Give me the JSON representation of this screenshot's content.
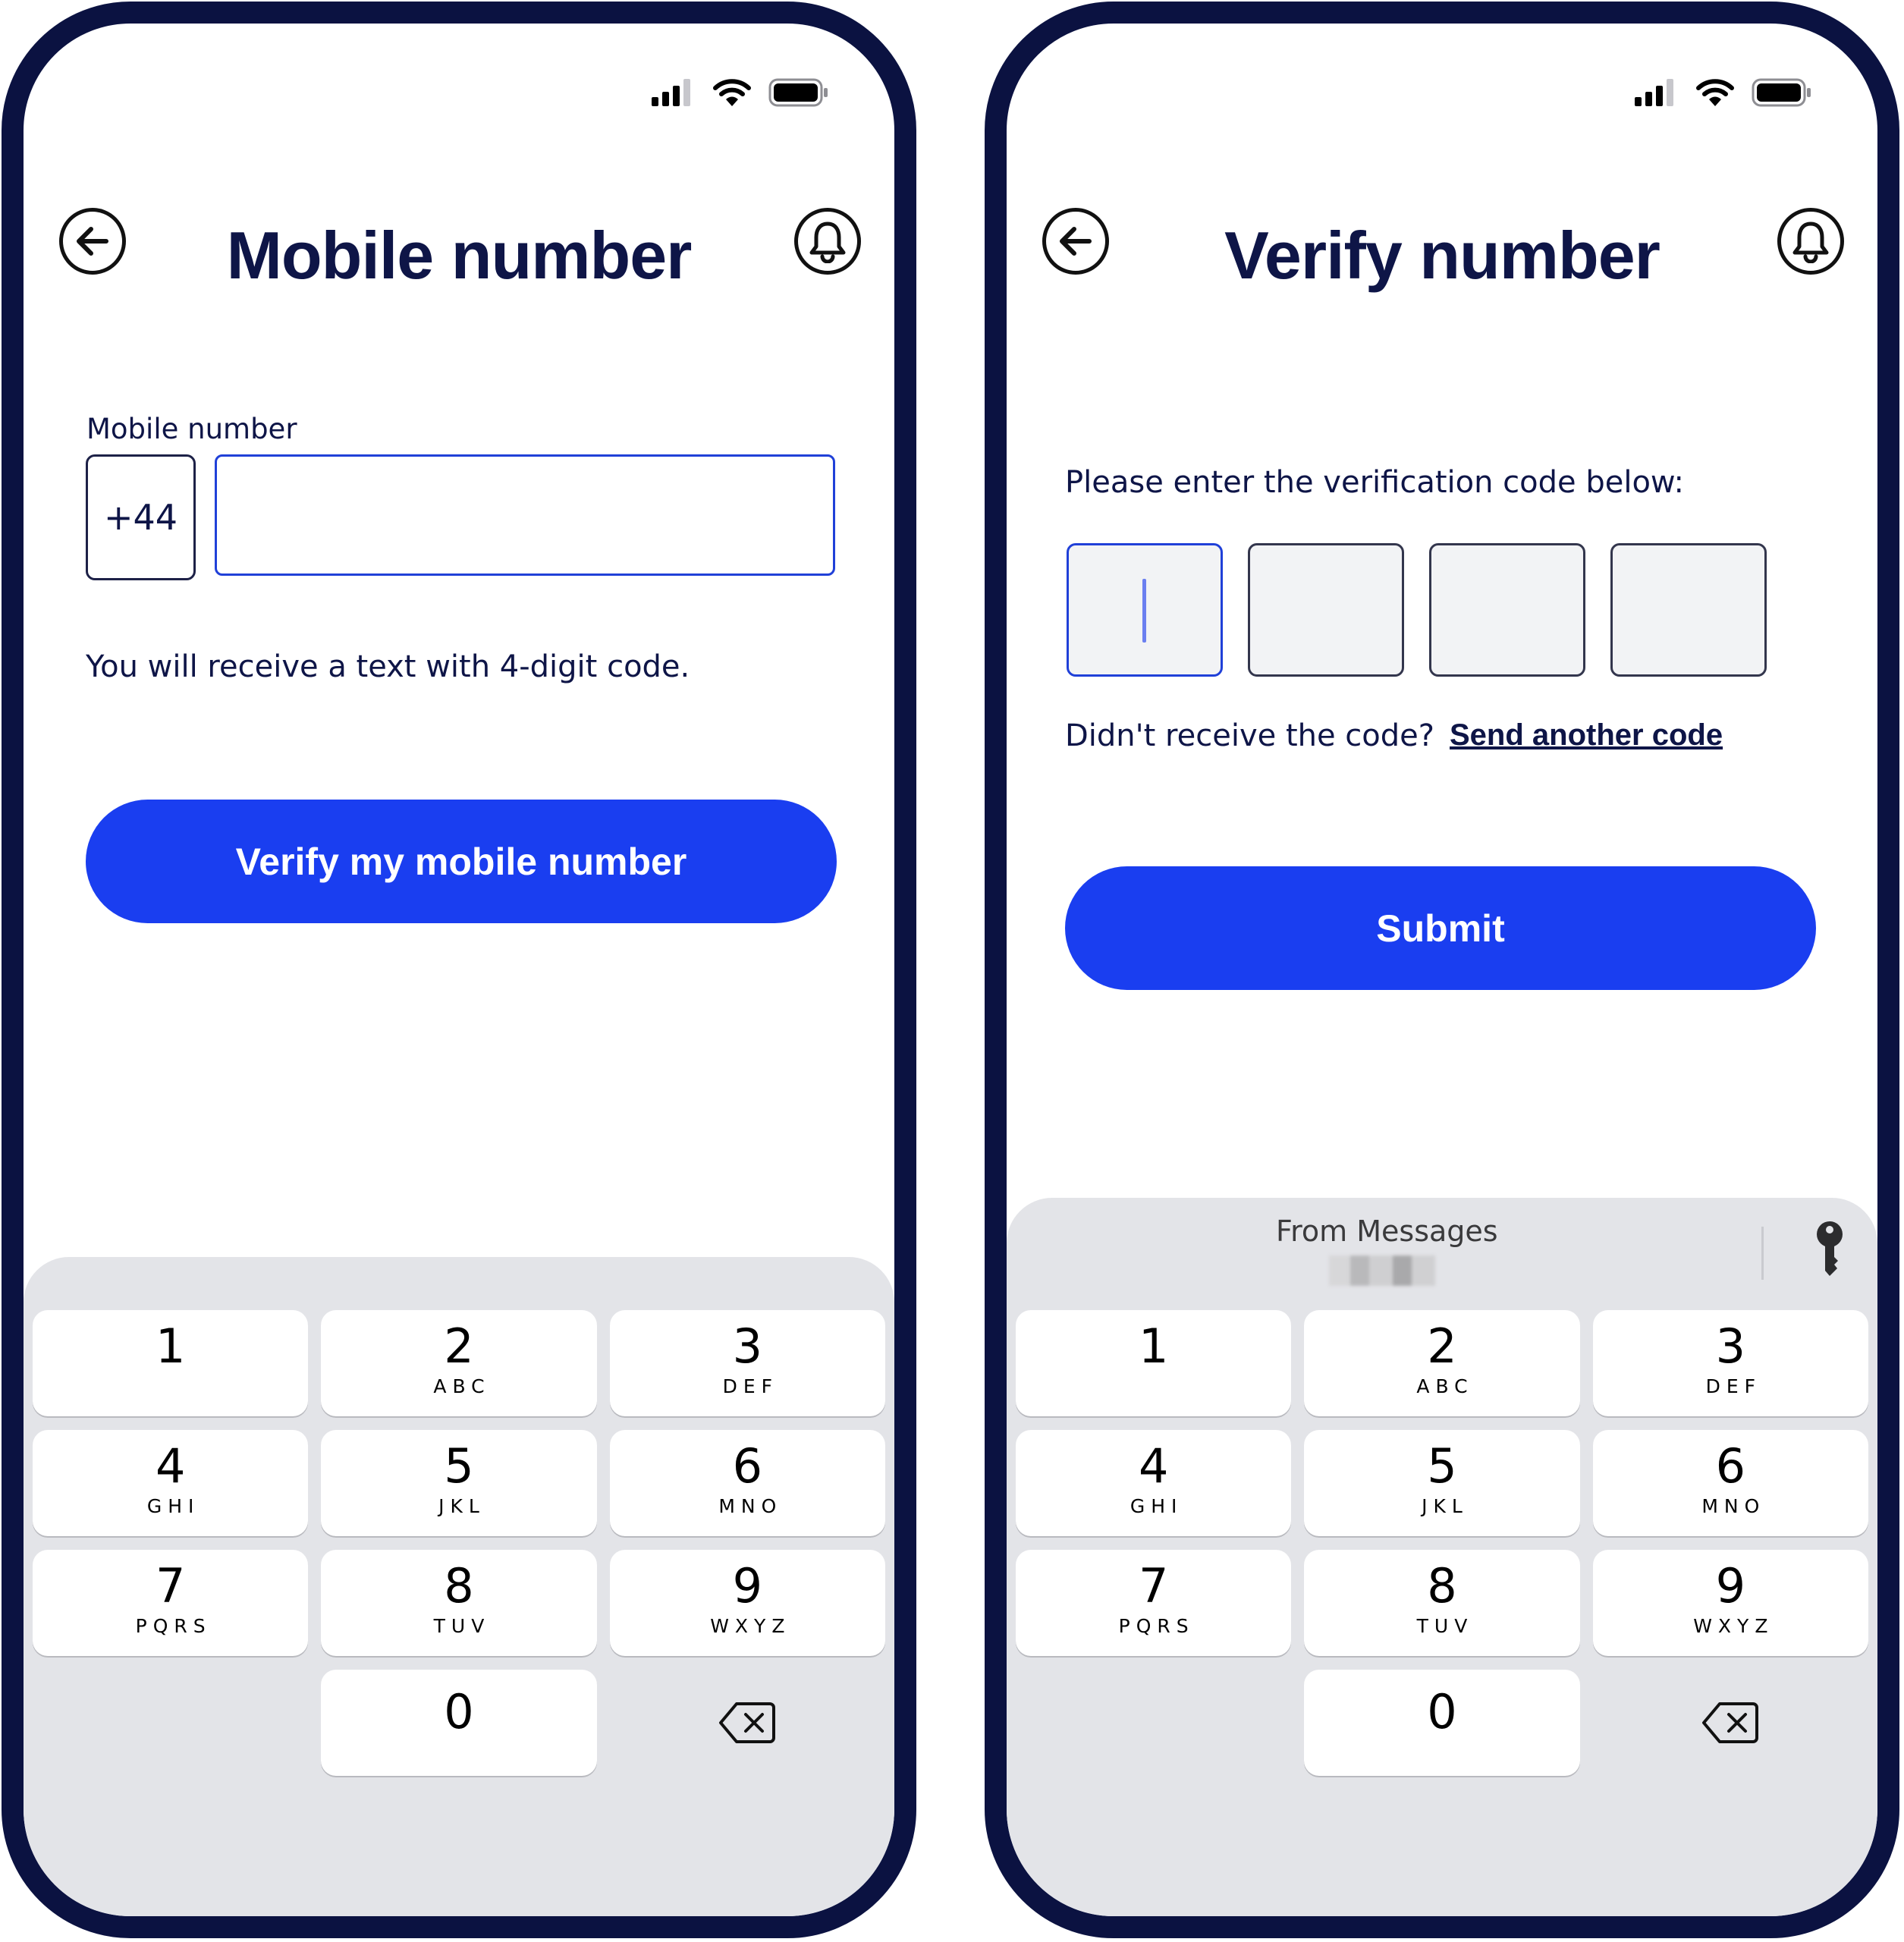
{
  "screens": [
    {
      "title": "Mobile number",
      "field_label": "Mobile number",
      "country_code": "+44",
      "phone_value": "",
      "helper_text": "You will receive a text with 4-digit code.",
      "primary_button": "Verify my mobile number"
    },
    {
      "title": "Verify number",
      "instruction": "Please enter the verification code below:",
      "code_digits": [
        "",
        "",
        "",
        ""
      ],
      "resend_prompt": "Didn't receive the code?",
      "resend_link": "Send another code",
      "primary_button": "Submit",
      "suggestion_label": "From Messages"
    }
  ],
  "keypad": [
    {
      "num": "1",
      "letters": ""
    },
    {
      "num": "2",
      "letters": "ABC"
    },
    {
      "num": "3",
      "letters": "DEF"
    },
    {
      "num": "4",
      "letters": "GHI"
    },
    {
      "num": "5",
      "letters": "JKL"
    },
    {
      "num": "6",
      "letters": "MNO"
    },
    {
      "num": "7",
      "letters": "PQRS"
    },
    {
      "num": "8",
      "letters": "TUV"
    },
    {
      "num": "9",
      "letters": "WXYZ"
    },
    {
      "num": "0",
      "letters": ""
    }
  ],
  "icons": {
    "back": "arrow-left-circle-icon",
    "notifications": "bell-icon",
    "signal": "cellular-signal-icon",
    "wifi": "wifi-icon",
    "battery": "battery-icon",
    "delete": "backspace-icon",
    "passwords": "key-icon"
  },
  "colors": {
    "frame": "#0b1241",
    "primary": "#1a3ef0",
    "text": "#0e1547",
    "keyboard_bg": "#e3e4e8"
  }
}
